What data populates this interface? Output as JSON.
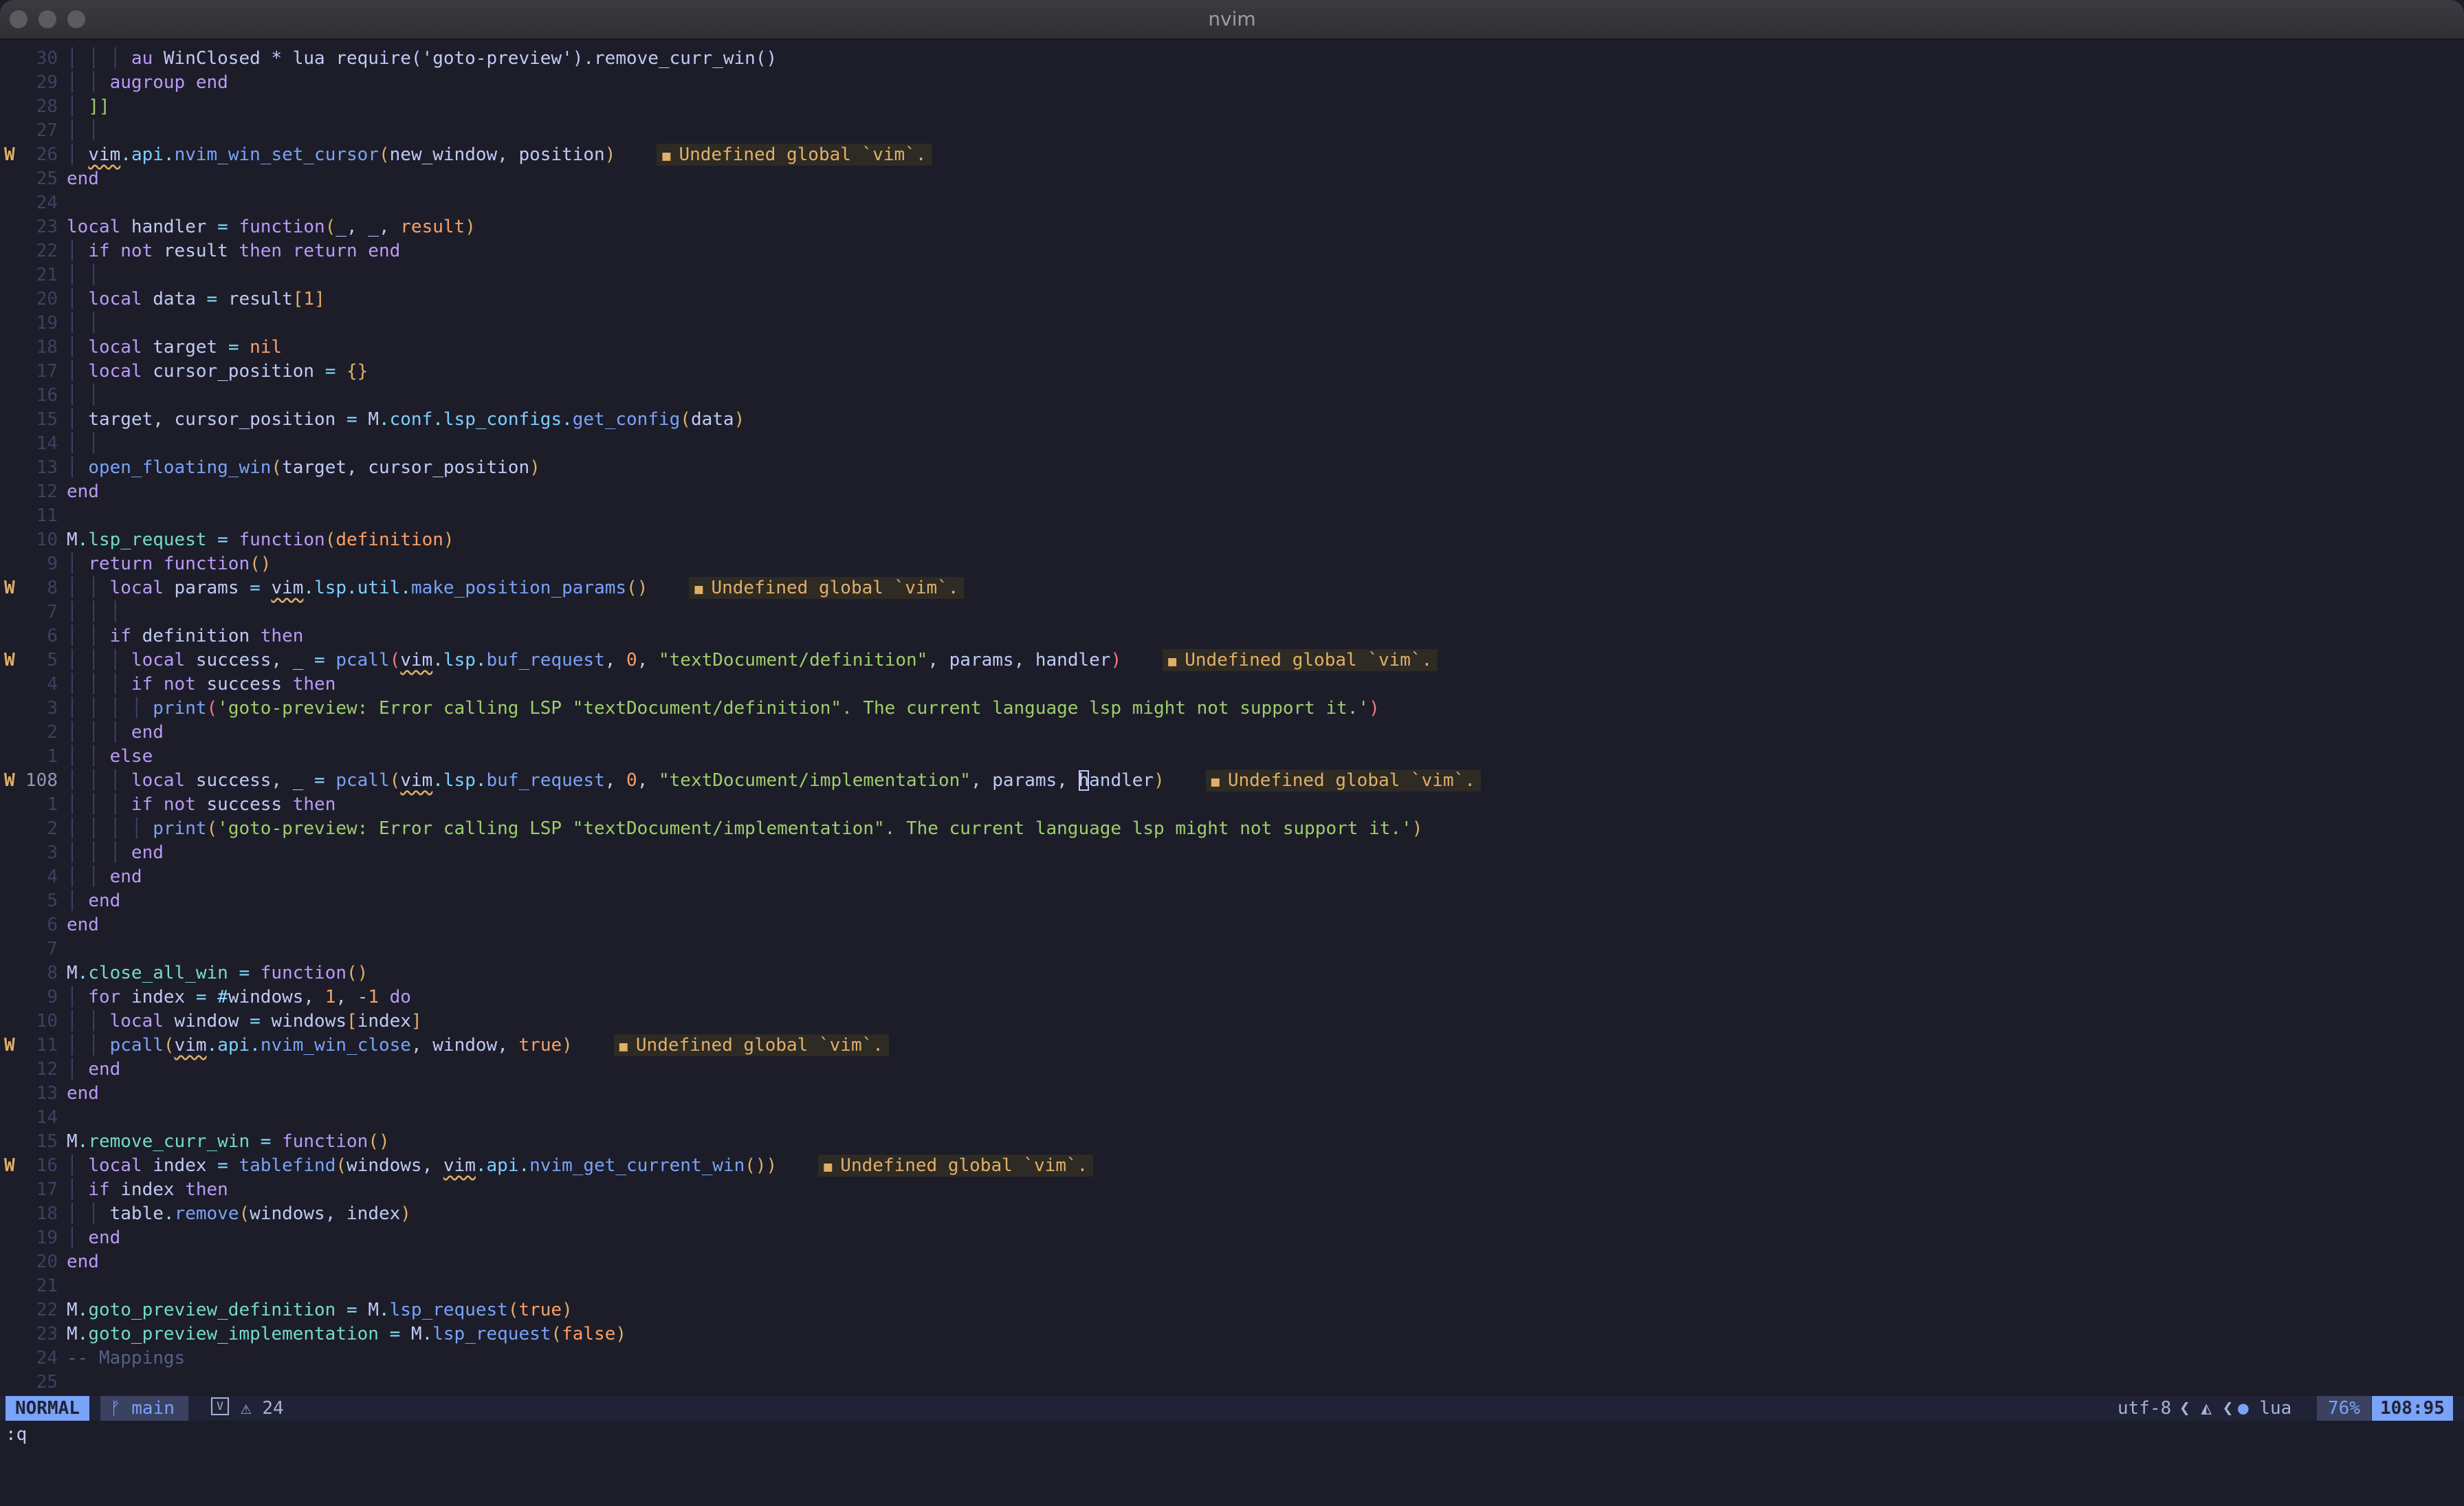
{
  "window": {
    "title": "nvim"
  },
  "diagnostic_message": "Undefined global `vim`.",
  "lines": [
    {
      "sign": "",
      "nr": "30",
      "code": [
        [
          "t-gd",
          "│ │ │ "
        ],
        [
          "t-kw",
          "au "
        ],
        [
          "t-var",
          "WinClosed * lua require('goto-preview').remove_curr_win()"
        ]
      ]
    },
    {
      "sign": "",
      "nr": "29",
      "code": [
        [
          "t-gd",
          "│ │ "
        ],
        [
          "t-kw",
          "augroup end"
        ]
      ]
    },
    {
      "sign": "",
      "nr": "28",
      "code": [
        [
          "t-gd",
          "│ "
        ],
        [
          "t-brk",
          "]]"
        ]
      ]
    },
    {
      "sign": "",
      "nr": "27",
      "code": [
        [
          "t-gd",
          "│ │"
        ]
      ]
    },
    {
      "sign": "W",
      "nr": "26",
      "diag": true,
      "code": [
        [
          "t-gd",
          "│ "
        ],
        [
          "t-var warnu",
          "vim"
        ],
        [
          "t-op",
          "."
        ],
        [
          "t-fld",
          "api"
        ],
        [
          "t-op",
          "."
        ],
        [
          "t-fn",
          "nvim_win_set_cursor"
        ],
        [
          "t-par",
          "("
        ],
        [
          "t-var",
          "new_window, position"
        ],
        [
          "t-par",
          ")"
        ]
      ]
    },
    {
      "sign": "",
      "nr": "25",
      "code": [
        [
          "t-kw",
          "end"
        ]
      ]
    },
    {
      "sign": "",
      "nr": "24",
      "code": []
    },
    {
      "sign": "",
      "nr": "23",
      "code": [
        [
          "t-kw",
          "local "
        ],
        [
          "t-var",
          "handler "
        ],
        [
          "t-op",
          "= "
        ],
        [
          "t-kw",
          "function"
        ],
        [
          "t-par",
          "("
        ],
        [
          "t-var",
          "_, _, "
        ],
        [
          "t-num",
          "result"
        ],
        [
          "t-par",
          ")"
        ]
      ]
    },
    {
      "sign": "",
      "nr": "22",
      "code": [
        [
          "t-gd",
          "│ "
        ],
        [
          "t-kw",
          "if not "
        ],
        [
          "t-var",
          "result "
        ],
        [
          "t-kw",
          "then return end"
        ]
      ]
    },
    {
      "sign": "",
      "nr": "21",
      "code": [
        [
          "t-gd",
          "│ │"
        ]
      ]
    },
    {
      "sign": "",
      "nr": "20",
      "code": [
        [
          "t-gd",
          "│ "
        ],
        [
          "t-kw",
          "local "
        ],
        [
          "t-var",
          "data "
        ],
        [
          "t-op",
          "= "
        ],
        [
          "t-var",
          "result"
        ],
        [
          "t-par",
          "["
        ],
        [
          "t-num",
          "1"
        ],
        [
          "t-par",
          "]"
        ]
      ]
    },
    {
      "sign": "",
      "nr": "19",
      "code": [
        [
          "t-gd",
          "│ │"
        ]
      ]
    },
    {
      "sign": "",
      "nr": "18",
      "code": [
        [
          "t-gd",
          "│ "
        ],
        [
          "t-kw",
          "local "
        ],
        [
          "t-var",
          "target "
        ],
        [
          "t-op",
          "= "
        ],
        [
          "t-num",
          "nil"
        ]
      ]
    },
    {
      "sign": "",
      "nr": "17",
      "code": [
        [
          "t-gd",
          "│ "
        ],
        [
          "t-kw",
          "local "
        ],
        [
          "t-var",
          "cursor_position "
        ],
        [
          "t-op",
          "= "
        ],
        [
          "t-par",
          "{}"
        ]
      ]
    },
    {
      "sign": "",
      "nr": "16",
      "code": [
        [
          "t-gd",
          "│ │"
        ]
      ]
    },
    {
      "sign": "",
      "nr": "15",
      "code": [
        [
          "t-gd",
          "│ "
        ],
        [
          "t-var",
          "target, cursor_position "
        ],
        [
          "t-op",
          "= "
        ],
        [
          "t-var",
          "M"
        ],
        [
          "t-op",
          "."
        ],
        [
          "t-fld",
          "conf"
        ],
        [
          "t-op",
          "."
        ],
        [
          "t-fld",
          "lsp_configs"
        ],
        [
          "t-op",
          "."
        ],
        [
          "t-fn",
          "get_config"
        ],
        [
          "t-par",
          "("
        ],
        [
          "t-var",
          "data"
        ],
        [
          "t-par",
          ")"
        ]
      ]
    },
    {
      "sign": "",
      "nr": "14",
      "code": [
        [
          "t-gd",
          "│ │"
        ]
      ]
    },
    {
      "sign": "",
      "nr": "13",
      "code": [
        [
          "t-gd",
          "│ "
        ],
        [
          "t-fn",
          "open_floating_win"
        ],
        [
          "t-par",
          "("
        ],
        [
          "t-var",
          "target, cursor_position"
        ],
        [
          "t-par",
          ")"
        ]
      ]
    },
    {
      "sign": "",
      "nr": "12",
      "code": [
        [
          "t-kw",
          "end"
        ]
      ]
    },
    {
      "sign": "",
      "nr": "11",
      "code": []
    },
    {
      "sign": "",
      "nr": "10",
      "code": [
        [
          "t-var",
          "M"
        ],
        [
          "t-op",
          "."
        ],
        [
          "t-prop",
          "lsp_request "
        ],
        [
          "t-op",
          "= "
        ],
        [
          "t-kw",
          "function"
        ],
        [
          "t-par",
          "("
        ],
        [
          "t-num",
          "definition"
        ],
        [
          "t-par",
          ")"
        ]
      ]
    },
    {
      "sign": "",
      "nr": "9",
      "code": [
        [
          "t-gd",
          "│ "
        ],
        [
          "t-kw",
          "return function"
        ],
        [
          "t-par",
          "()"
        ]
      ]
    },
    {
      "sign": "W",
      "nr": "8",
      "diag": true,
      "code": [
        [
          "t-gd",
          "│ │ "
        ],
        [
          "t-kw",
          "local "
        ],
        [
          "t-var",
          "params "
        ],
        [
          "t-op",
          "= "
        ],
        [
          "t-var warnu",
          "vim"
        ],
        [
          "t-op",
          "."
        ],
        [
          "t-fld",
          "lsp"
        ],
        [
          "t-op",
          "."
        ],
        [
          "t-fld",
          "util"
        ],
        [
          "t-op",
          "."
        ],
        [
          "t-fn",
          "make_position_params"
        ],
        [
          "t-par",
          "()"
        ]
      ]
    },
    {
      "sign": "",
      "nr": "7",
      "code": [
        [
          "t-gd",
          "│ │ │"
        ]
      ]
    },
    {
      "sign": "",
      "nr": "6",
      "code": [
        [
          "t-gd",
          "│ │ "
        ],
        [
          "t-kw",
          "if "
        ],
        [
          "t-var",
          "definition "
        ],
        [
          "t-kw",
          "then"
        ]
      ]
    },
    {
      "sign": "W",
      "nr": "5",
      "diag": true,
      "code": [
        [
          "t-gd",
          "│ │ │ "
        ],
        [
          "t-kw",
          "local "
        ],
        [
          "t-var",
          "success, _ "
        ],
        [
          "t-op",
          "= "
        ],
        [
          "t-fn",
          "pcall"
        ],
        [
          "t-red",
          "("
        ],
        [
          "t-var warnu",
          "vim"
        ],
        [
          "t-op",
          "."
        ],
        [
          "t-fld",
          "lsp"
        ],
        [
          "t-op",
          "."
        ],
        [
          "t-fn",
          "buf_request"
        ],
        [
          "t-var",
          ", "
        ],
        [
          "t-num",
          "0"
        ],
        [
          "t-var",
          ", "
        ],
        [
          "t-str",
          "\"textDocument/definition\""
        ],
        [
          "t-var",
          ", params, handler"
        ],
        [
          "t-red",
          ")"
        ]
      ]
    },
    {
      "sign": "",
      "nr": "4",
      "code": [
        [
          "t-gd",
          "│ │ │ "
        ],
        [
          "t-kw",
          "if not "
        ],
        [
          "t-var",
          "success "
        ],
        [
          "t-kw",
          "then"
        ]
      ]
    },
    {
      "sign": "",
      "nr": "3",
      "code": [
        [
          "t-gd",
          "│ │ │ │ "
        ],
        [
          "t-fn",
          "print"
        ],
        [
          "t-red",
          "("
        ],
        [
          "t-str",
          "'goto-preview: Error calling LSP \"textDocument/definition\". The current language lsp might not support it.'"
        ],
        [
          "t-red",
          ")"
        ]
      ]
    },
    {
      "sign": "",
      "nr": "2",
      "code": [
        [
          "t-gd",
          "│ │ │ "
        ],
        [
          "t-kw",
          "end"
        ]
      ]
    },
    {
      "sign": "",
      "nr": "1",
      "code": [
        [
          "t-gd",
          "│ │ "
        ],
        [
          "t-kw",
          "else"
        ]
      ]
    },
    {
      "sign": "W",
      "nr": "108",
      "cur": true,
      "diag": true,
      "code": [
        [
          "t-gd",
          "│ │ │ "
        ],
        [
          "t-kw",
          "local "
        ],
        [
          "t-var",
          "success, _ "
        ],
        [
          "t-op",
          "= "
        ],
        [
          "t-fn",
          "pcall"
        ],
        [
          "t-par",
          "("
        ],
        [
          "t-var warnu",
          "vim"
        ],
        [
          "t-op",
          "."
        ],
        [
          "t-fld",
          "lsp"
        ],
        [
          "t-op",
          "."
        ],
        [
          "t-fn",
          "buf_request"
        ],
        [
          "t-var",
          ", "
        ],
        [
          "t-num",
          "0"
        ],
        [
          "t-var",
          ", "
        ],
        [
          "t-str",
          "\"textDocument/implementation\""
        ],
        [
          "t-var",
          ", params, "
        ],
        [
          "t-var cursor",
          "h"
        ],
        [
          "t-var",
          "andler"
        ],
        [
          "t-par",
          ")"
        ]
      ]
    },
    {
      "sign": "",
      "nr": "1",
      "code": [
        [
          "t-gd",
          "│ │ │ "
        ],
        [
          "t-kw",
          "if not "
        ],
        [
          "t-var",
          "success "
        ],
        [
          "t-kw",
          "then"
        ]
      ]
    },
    {
      "sign": "",
      "nr": "2",
      "code": [
        [
          "t-gd",
          "│ │ │ │ "
        ],
        [
          "t-fn",
          "print"
        ],
        [
          "t-par",
          "("
        ],
        [
          "t-str",
          "'goto-preview: Error calling LSP \"textDocument/implementation\". The current language lsp might not support it.'"
        ],
        [
          "t-par",
          ")"
        ]
      ]
    },
    {
      "sign": "",
      "nr": "3",
      "code": [
        [
          "t-gd",
          "│ │ │ "
        ],
        [
          "t-kw",
          "end"
        ]
      ]
    },
    {
      "sign": "",
      "nr": "4",
      "code": [
        [
          "t-gd",
          "│ │ "
        ],
        [
          "t-kw",
          "end"
        ]
      ]
    },
    {
      "sign": "",
      "nr": "5",
      "code": [
        [
          "t-gd",
          "│ "
        ],
        [
          "t-kw",
          "end"
        ]
      ]
    },
    {
      "sign": "",
      "nr": "6",
      "code": [
        [
          "t-kw",
          "end"
        ]
      ]
    },
    {
      "sign": "",
      "nr": "7",
      "code": []
    },
    {
      "sign": "",
      "nr": "8",
      "code": [
        [
          "t-var",
          "M"
        ],
        [
          "t-op",
          "."
        ],
        [
          "t-prop",
          "close_all_win "
        ],
        [
          "t-op",
          "= "
        ],
        [
          "t-kw",
          "function"
        ],
        [
          "t-par",
          "()"
        ]
      ]
    },
    {
      "sign": "",
      "nr": "9",
      "code": [
        [
          "t-gd",
          "│ "
        ],
        [
          "t-kw",
          "for "
        ],
        [
          "t-var",
          "index "
        ],
        [
          "t-op",
          "= #"
        ],
        [
          "t-var",
          "windows, "
        ],
        [
          "t-num",
          "1"
        ],
        [
          "t-var",
          ", "
        ],
        [
          "t-op",
          "-"
        ],
        [
          "t-num",
          "1 "
        ],
        [
          "t-kw",
          "do"
        ]
      ]
    },
    {
      "sign": "",
      "nr": "10",
      "code": [
        [
          "t-gd",
          "│ │ "
        ],
        [
          "t-kw",
          "local "
        ],
        [
          "t-var",
          "window "
        ],
        [
          "t-op",
          "= "
        ],
        [
          "t-var",
          "windows"
        ],
        [
          "t-par",
          "["
        ],
        [
          "t-var",
          "index"
        ],
        [
          "t-par",
          "]"
        ]
      ]
    },
    {
      "sign": "W",
      "nr": "11",
      "diag": true,
      "code": [
        [
          "t-gd",
          "│ │ "
        ],
        [
          "t-fn",
          "pcall"
        ],
        [
          "t-par",
          "("
        ],
        [
          "t-var warnu",
          "vim"
        ],
        [
          "t-op",
          "."
        ],
        [
          "t-fld",
          "api"
        ],
        [
          "t-op",
          "."
        ],
        [
          "t-fn",
          "nvim_win_close"
        ],
        [
          "t-var",
          ", window, "
        ],
        [
          "t-bool",
          "true"
        ],
        [
          "t-par",
          ")"
        ]
      ]
    },
    {
      "sign": "",
      "nr": "12",
      "code": [
        [
          "t-gd",
          "│ "
        ],
        [
          "t-kw",
          "end"
        ]
      ]
    },
    {
      "sign": "",
      "nr": "13",
      "code": [
        [
          "t-kw",
          "end"
        ]
      ]
    },
    {
      "sign": "",
      "nr": "14",
      "code": []
    },
    {
      "sign": "",
      "nr": "15",
      "code": [
        [
          "t-var",
          "M"
        ],
        [
          "t-op",
          "."
        ],
        [
          "t-prop",
          "remove_curr_win "
        ],
        [
          "t-op",
          "= "
        ],
        [
          "t-kw",
          "function"
        ],
        [
          "t-par",
          "()"
        ]
      ]
    },
    {
      "sign": "W",
      "nr": "16",
      "diag": true,
      "code": [
        [
          "t-gd",
          "│ "
        ],
        [
          "t-kw",
          "local "
        ],
        [
          "t-var",
          "index "
        ],
        [
          "t-op",
          "= "
        ],
        [
          "t-fn",
          "tablefind"
        ],
        [
          "t-par",
          "("
        ],
        [
          "t-var",
          "windows, "
        ],
        [
          "t-var warnu",
          "vim"
        ],
        [
          "t-op",
          "."
        ],
        [
          "t-fld",
          "api"
        ],
        [
          "t-op",
          "."
        ],
        [
          "t-fn",
          "nvim_get_current_win"
        ],
        [
          "t-par",
          "())"
        ]
      ]
    },
    {
      "sign": "",
      "nr": "17",
      "code": [
        [
          "t-gd",
          "│ "
        ],
        [
          "t-kw",
          "if "
        ],
        [
          "t-var",
          "index "
        ],
        [
          "t-kw",
          "then"
        ]
      ]
    },
    {
      "sign": "",
      "nr": "18",
      "code": [
        [
          "t-gd",
          "│ │ "
        ],
        [
          "t-var",
          "table"
        ],
        [
          "t-op",
          "."
        ],
        [
          "t-fn",
          "remove"
        ],
        [
          "t-par",
          "("
        ],
        [
          "t-var",
          "windows, index"
        ],
        [
          "t-par",
          ")"
        ]
      ]
    },
    {
      "sign": "",
      "nr": "19",
      "code": [
        [
          "t-gd",
          "│ "
        ],
        [
          "t-kw",
          "end"
        ]
      ]
    },
    {
      "sign": "",
      "nr": "20",
      "code": [
        [
          "t-kw",
          "end"
        ]
      ]
    },
    {
      "sign": "",
      "nr": "21",
      "code": []
    },
    {
      "sign": "",
      "nr": "22",
      "code": [
        [
          "t-var",
          "M"
        ],
        [
          "t-op",
          "."
        ],
        [
          "t-prop",
          "goto_preview_definition "
        ],
        [
          "t-op",
          "= "
        ],
        [
          "t-var",
          "M"
        ],
        [
          "t-op",
          "."
        ],
        [
          "t-fn",
          "lsp_request"
        ],
        [
          "t-par",
          "("
        ],
        [
          "t-bool",
          "true"
        ],
        [
          "t-par",
          ")"
        ]
      ]
    },
    {
      "sign": "",
      "nr": "23",
      "code": [
        [
          "t-var",
          "M"
        ],
        [
          "t-op",
          "."
        ],
        [
          "t-prop",
          "goto_preview_implementation "
        ],
        [
          "t-op",
          "= "
        ],
        [
          "t-var",
          "M"
        ],
        [
          "t-op",
          "."
        ],
        [
          "t-fn",
          "lsp_request"
        ],
        [
          "t-par",
          "("
        ],
        [
          "t-bool",
          "false"
        ],
        [
          "t-par",
          ")"
        ]
      ]
    },
    {
      "sign": "",
      "nr": "24",
      "code": [
        [
          "t-cm",
          "-- Mappings"
        ]
      ]
    },
    {
      "sign": "",
      "nr": "25",
      "code": []
    }
  ],
  "statusline": {
    "mode": "NORMAL",
    "branch_icon": "git-branch-icon",
    "branch": "main",
    "vim_icon": "V",
    "warning_count": "24",
    "encoding": "utf-8",
    "os_icon": "linux-icon",
    "filetype_icon": "lua-icon",
    "filetype": "lua",
    "progress": "76%",
    "position": "108:95"
  },
  "cmdline": ":q",
  "colors": {
    "background": "#1c1d29",
    "mode_bg": "#7aa2f7",
    "warning": "#e0af68"
  }
}
